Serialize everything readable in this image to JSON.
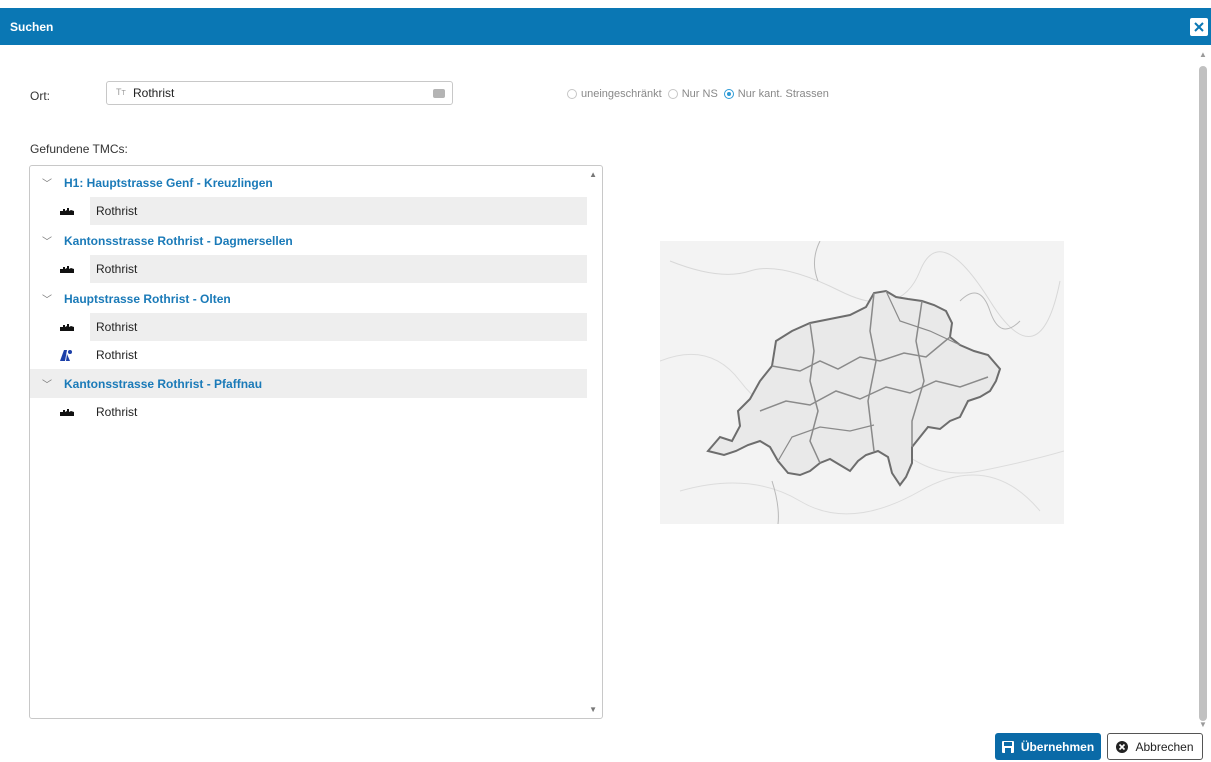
{
  "dialog": {
    "title": "Suchen",
    "close_icon": "close-icon"
  },
  "search": {
    "label": "Ort:",
    "value": "Rothrist",
    "type_icon": "text-type-icon",
    "clear_icon": "clear-input-icon"
  },
  "filter": {
    "options": [
      {
        "label": "uneingeschränkt",
        "checked": false
      },
      {
        "label": "Nur NS",
        "checked": false
      },
      {
        "label": "Nur kant. Strassen",
        "checked": true
      }
    ],
    "accent_color": "#2d9ad6"
  },
  "results": {
    "label": "Gefundene TMCs:",
    "groups": [
      {
        "title": "H1: Hauptstrasse Genf - Kreuzlingen",
        "items": [
          {
            "label": "Rothrist",
            "icon": "town-icon"
          }
        ]
      },
      {
        "title": "Kantonsstrasse Rothrist - Dagmersellen",
        "items": [
          {
            "label": "Rothrist",
            "icon": "town-icon"
          }
        ]
      },
      {
        "title": "Hauptstrasse Rothrist - Olten",
        "items": [
          {
            "label": "Rothrist",
            "icon": "town-icon"
          },
          {
            "label": "Rothrist",
            "icon": "road-junction-icon"
          }
        ]
      },
      {
        "title": "Kantonsstrasse Rothrist - Pfaffnau",
        "items": [
          {
            "label": "Rothrist",
            "icon": "town-icon"
          }
        ]
      }
    ]
  },
  "map": {
    "description_icon": "switzerland-map"
  },
  "buttons": {
    "apply_label": "Übernehmen",
    "cancel_label": "Abbrechen"
  },
  "colors": {
    "titlebar": "#0a77b4",
    "group_title": "#1a7ab8",
    "apply_button": "#0a6aa7"
  }
}
